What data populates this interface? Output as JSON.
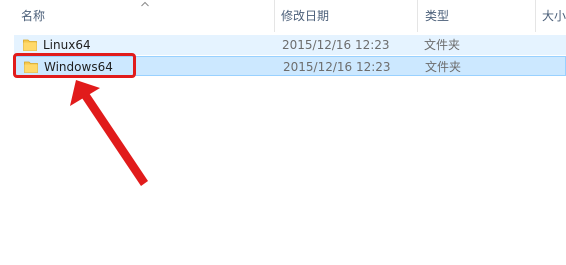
{
  "columns": {
    "name": "名称",
    "date_modified": "修改日期",
    "type": "类型",
    "size": "大小"
  },
  "files": [
    {
      "name": "Linux64",
      "date_modified": "2015/12/16 12:23",
      "type": "文件夹",
      "icon": "folder-icon",
      "state": "hover"
    },
    {
      "name": "Windows64",
      "date_modified": "2015/12/16 12:23",
      "type": "文件夹",
      "icon": "folder-icon",
      "state": "selected"
    }
  ],
  "colors": {
    "highlight": "#e11b1b",
    "selection": "#cce8ff",
    "hover": "#e5f3ff",
    "header_text": "#4c607a"
  }
}
